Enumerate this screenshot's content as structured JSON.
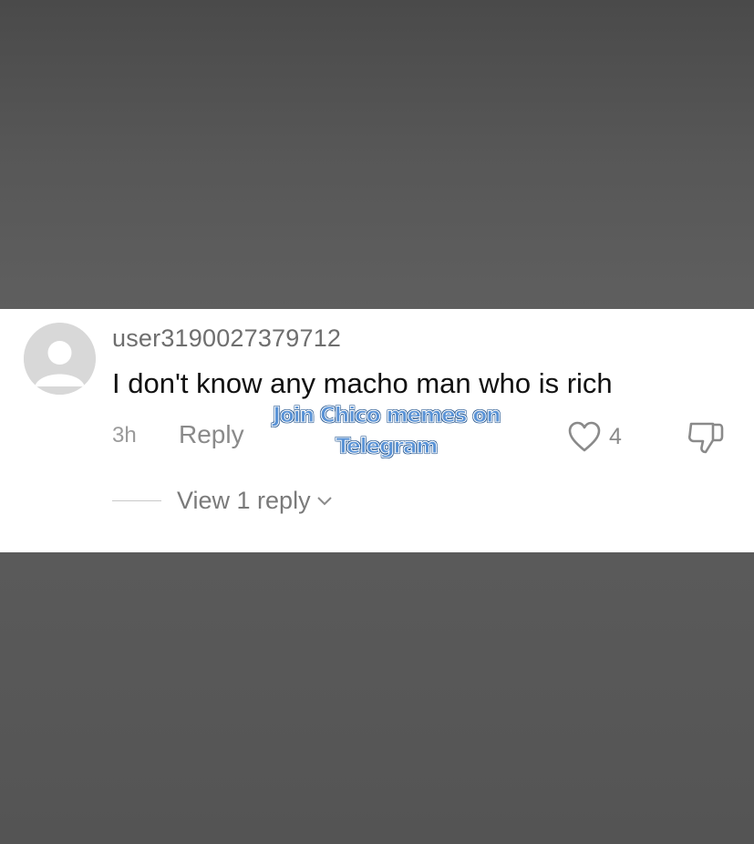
{
  "comment": {
    "username": "user3190027379712",
    "text": "I don't know any macho man who is rich",
    "time": "3h",
    "reply_label": "Reply",
    "like_count": "4",
    "view_replies_label": "View 1 reply"
  },
  "watermark": {
    "line1": "Join Chico memes on",
    "line2": "Telegram"
  },
  "icons": {
    "avatar": "default-avatar-icon",
    "like": "heart-outline-icon",
    "dislike": "thumbs-down-icon",
    "expand": "chevron-down-icon"
  },
  "colors": {
    "background": "#555555",
    "card": "#ffffff",
    "secondary_text": "#8a8a8a",
    "watermark": "#5a93d6"
  }
}
